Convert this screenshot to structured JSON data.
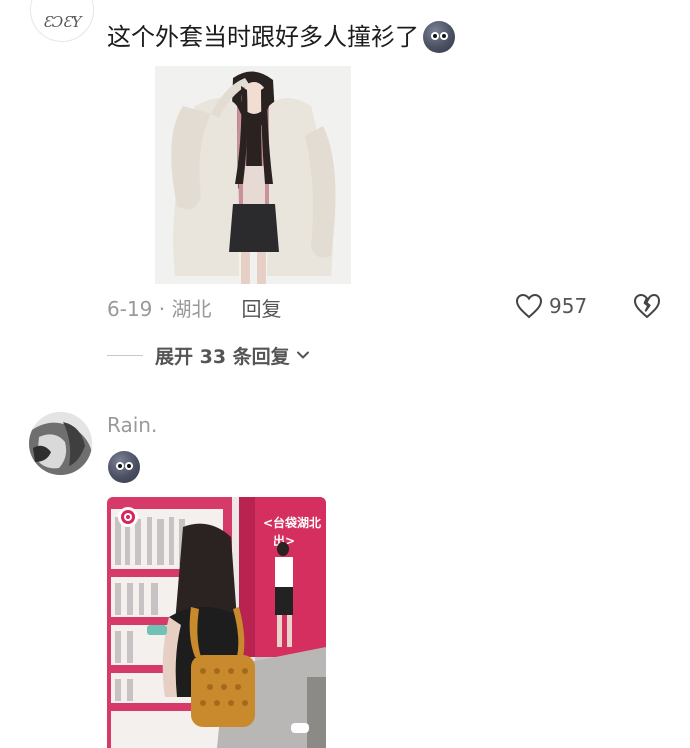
{
  "comments": [
    {
      "avatar_text": "ƐƆƐY",
      "text": "这个外套当时跟好多人撞衫了",
      "emoji": "blue-face-emoji",
      "date_location": "6-19 · 湖北",
      "reply_label": "回复",
      "likes": "957",
      "expand_replies": "展开 33 条回复"
    },
    {
      "username": "Rain.",
      "emoji": "blue-face-emoji",
      "sign_text": "<台袋湖北\n出>"
    }
  ],
  "colors": {
    "text_primary": "#1c1c1c",
    "text_secondary": "#999999",
    "accent_pink": "#d4285b"
  }
}
